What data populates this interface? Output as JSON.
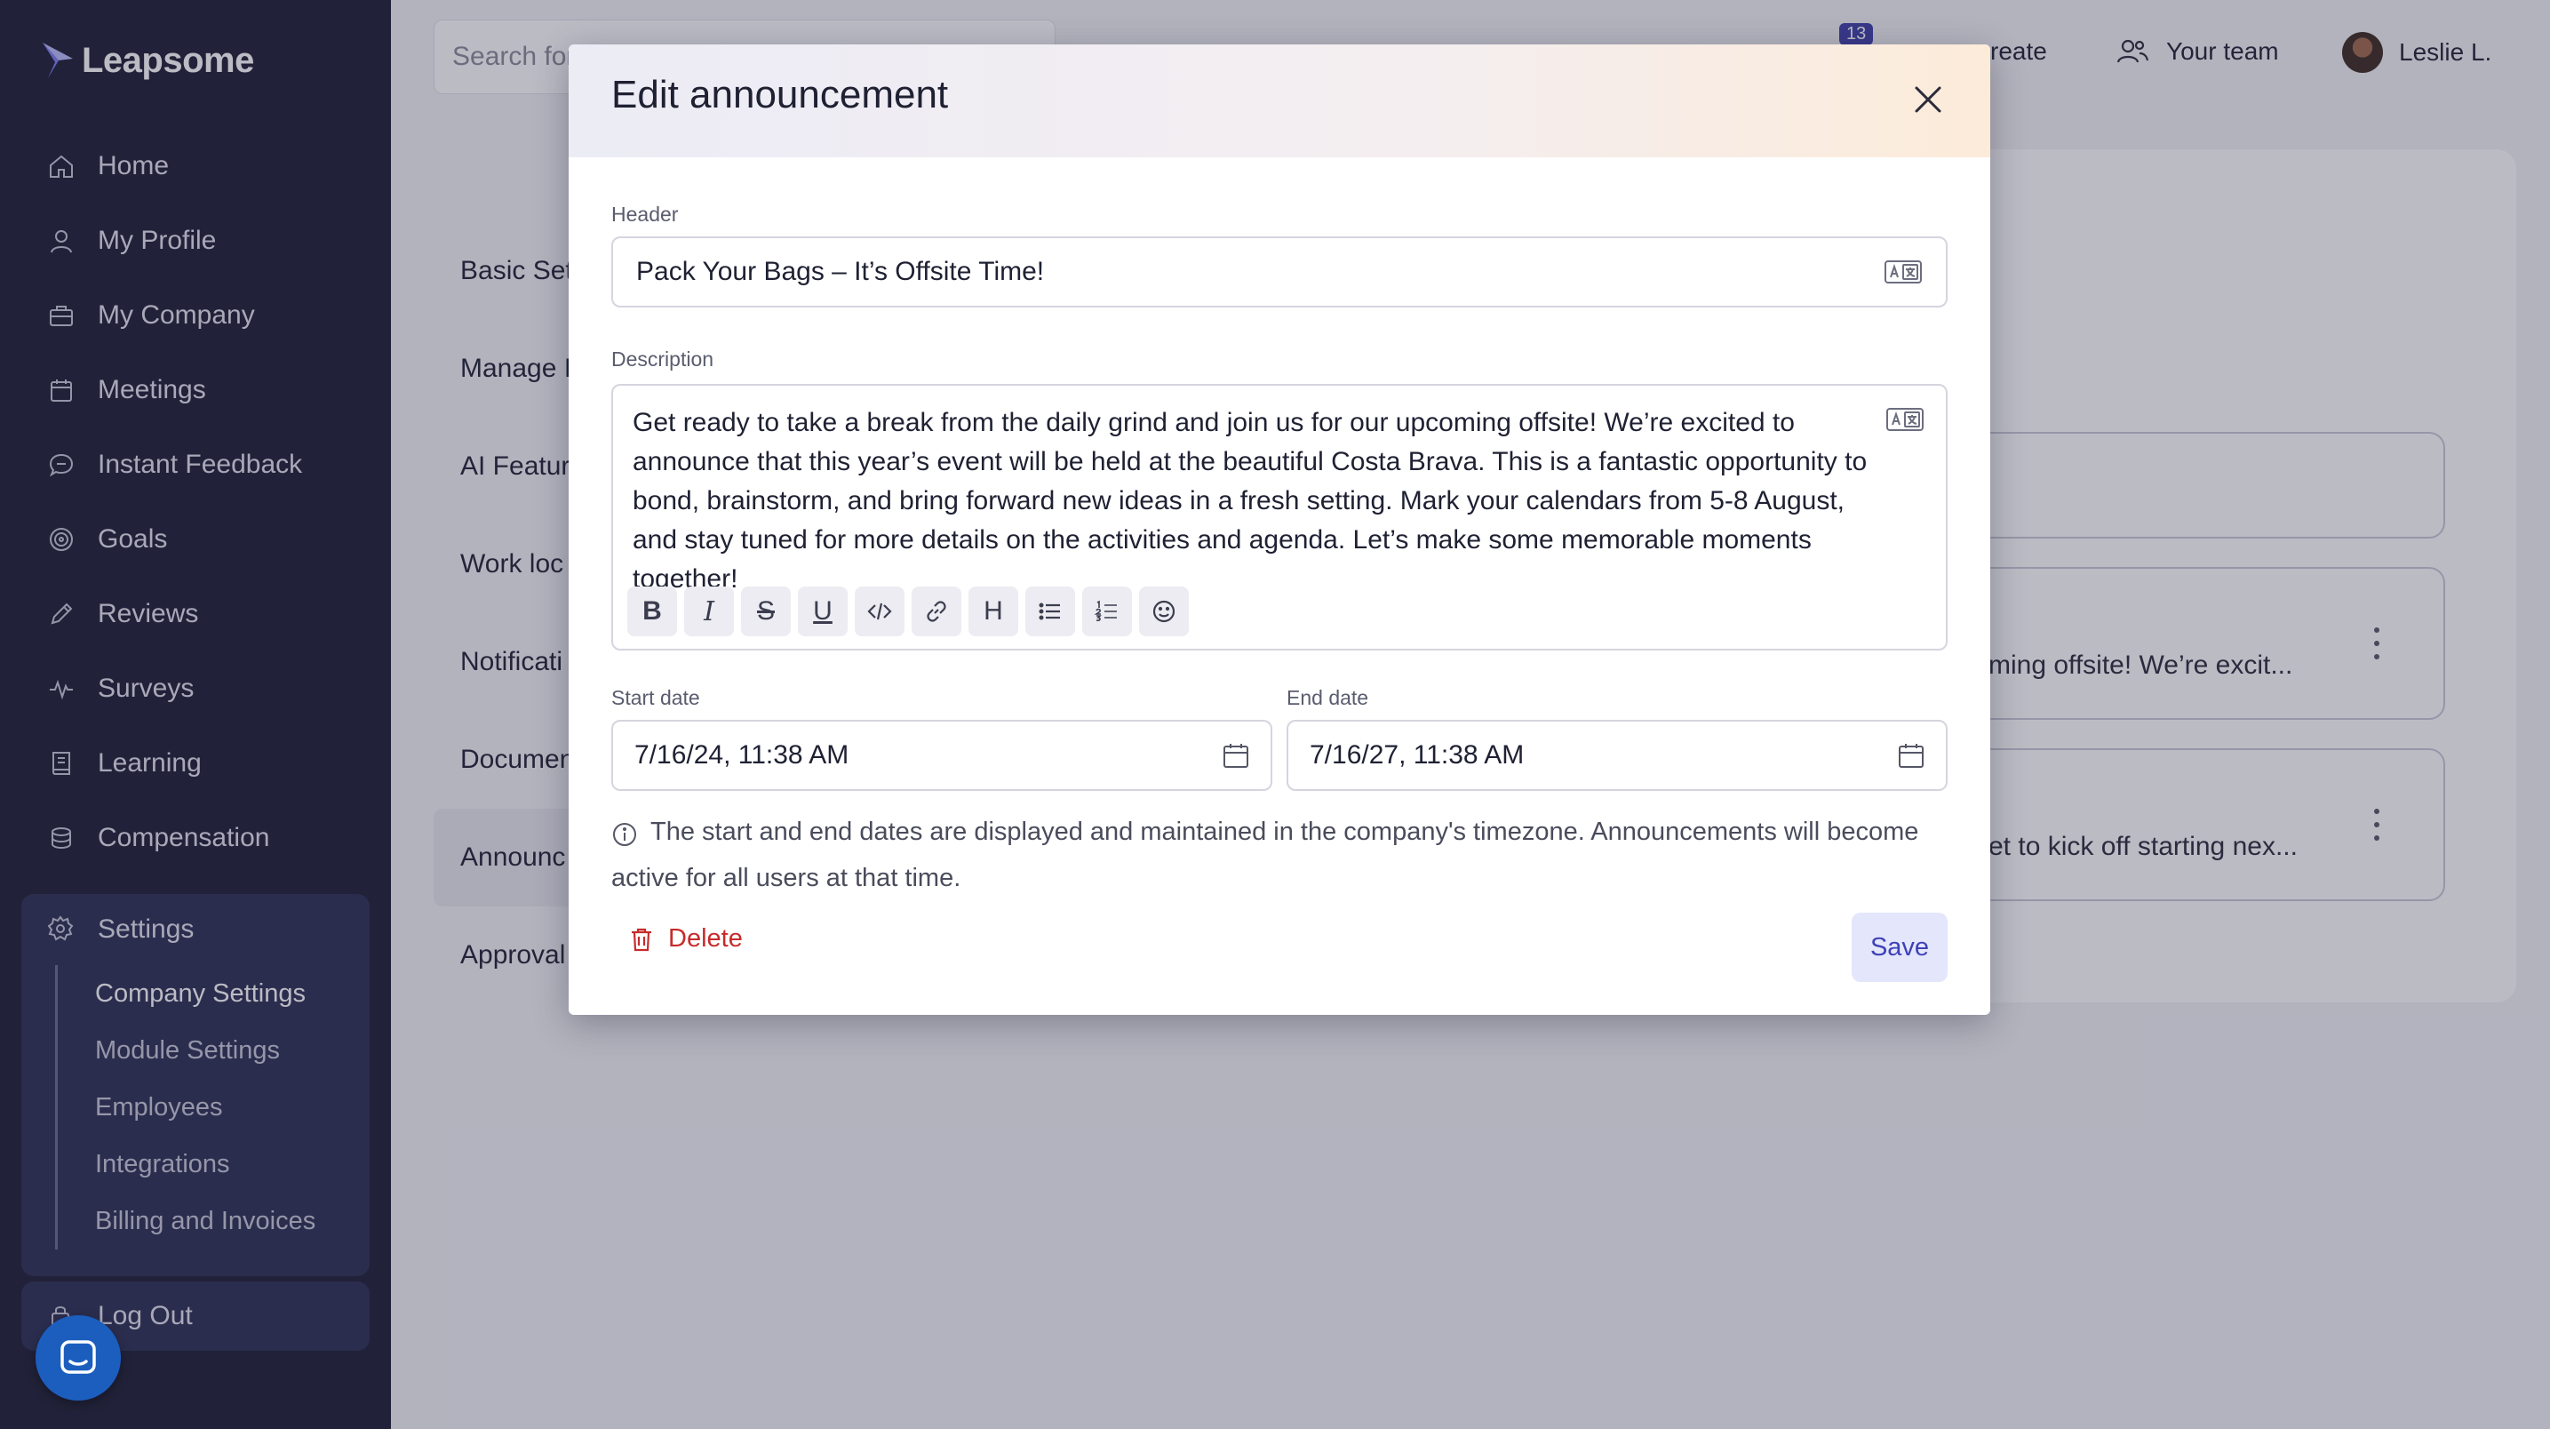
{
  "brand": {
    "name": "Leapsome",
    "accent": "#3f3fa8",
    "sidebar_bg": "#1c1d33"
  },
  "sidebar": {
    "items": [
      {
        "label": "Home",
        "icon": "home-icon"
      },
      {
        "label": "My Profile",
        "icon": "user-icon"
      },
      {
        "label": "My Company",
        "icon": "briefcase-icon"
      },
      {
        "label": "Meetings",
        "icon": "calendar-icon"
      },
      {
        "label": "Instant Feedback",
        "icon": "chat-icon"
      },
      {
        "label": "Goals",
        "icon": "target-icon"
      },
      {
        "label": "Reviews",
        "icon": "pencil-icon"
      },
      {
        "label": "Surveys",
        "icon": "pulse-icon"
      },
      {
        "label": "Learning",
        "icon": "book-icon"
      },
      {
        "label": "Compensation",
        "icon": "coins-icon"
      }
    ],
    "settings": {
      "label": "Settings",
      "sub_items": [
        "Company Settings",
        "Module Settings",
        "Employees",
        "Integrations",
        "Billing and Invoices"
      ],
      "active": "Company Settings"
    },
    "logout_label": "Log Out"
  },
  "topbar": {
    "search_placeholder": "Search for",
    "badge_count": "13",
    "create_label": "reate",
    "team_label": "Your team",
    "user_name": "Leslie L."
  },
  "settings_menu": {
    "items": [
      "Basic Set",
      "Manage I",
      "AI Featur",
      "Work loc",
      "Notificati",
      "Documen",
      "Announc",
      "Approval"
    ],
    "active": "Announc"
  },
  "background_cards": [
    {
      "snippet": "ming offsite! We’re excit..."
    },
    {
      "snippet": "et to kick off starting nex..."
    }
  ],
  "modal": {
    "title": "Edit announcement",
    "header_label": "Header",
    "header_value": "Pack Your Bags – It’s Offsite Time!",
    "description_label": "Description",
    "description_value": "Get ready to take a break from the daily grind and join us for our upcoming offsite! We’re excited to announce that this year’s event will be held at the beautiful Costa Brava. This is a fantastic opportunity to bond, brainstorm, and bring forward new ideas in a fresh setting. Mark your calendars from 5-8 August, and stay tuned for more details on the activities and agenda. Let’s make some memorable moments together!",
    "start_label": "Start date",
    "start_value": "7/16/24, 11:38 AM",
    "end_label": "End date",
    "end_value": "7/16/27, 11:38 AM",
    "info_text": "The start and end dates are displayed and maintained in the company's timezone. Announcements will become active for all users at that time.",
    "delete_label": "Delete",
    "save_label": "Save"
  },
  "toolbar": {
    "bold": "B",
    "italic": "I",
    "strikethrough": "S",
    "underline": "U",
    "heading": "H"
  }
}
